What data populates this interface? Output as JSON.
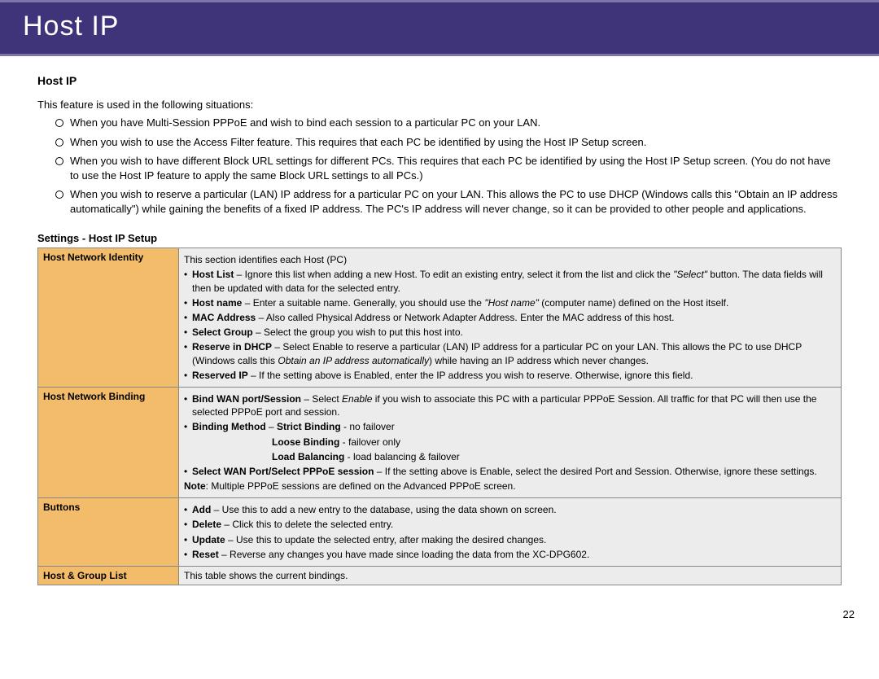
{
  "header": {
    "title": "Host IP"
  },
  "section_title": "Host IP",
  "intro": "This feature is used in the following situations:",
  "situations": [
    "When you have Multi-Session PPPoE and wish to bind each session to a particular PC on your LAN.",
    "When you wish to use the Access Filter feature. This requires that each PC be identified by using the Host IP Setup screen.",
    "When you wish to have different Block URL settings for different PCs. This requires that each PC be identified by using the Host IP Setup screen. (You do not have to use the Host IP feature to apply the same Block URL settings to all PCs.)",
    "When you wish to reserve a particular (LAN) IP address for a particular PC on your LAN. This allows the PC to use DHCP (Windows calls this \"Obtain an IP address automatically\") while gaining the benefits of a fixed IP address. The PC's IP address will never change, so it can be provided to other people and applications."
  ],
  "sub_title": "Settings - Host IP Setup",
  "rows": {
    "identity": {
      "label": "Host Network Identity",
      "intro": "This section identifies each Host (PC)",
      "hostlist_label": "Host List",
      "hostlist_text_a": " – Ignore this list when adding a new Host. To edit an existing entry, select it from the list and click the ",
      "hostlist_ital": "\"Select\"",
      "hostlist_text_b": " button. The data fields will then be updated with data for the selected entry.",
      "hostname_label": "Host name",
      "hostname_text_a": " – Enter a suitable name. Generally, you should use the ",
      "hostname_ital": "\"Host name\"",
      "hostname_text_b": " (computer name) defined on the Host itself.",
      "mac_label": "MAC Address",
      "mac_text": " – Also called Physical Address or Network Adapter Address. Enter the MAC address of this host.",
      "selgrp_label": "Select Group",
      "selgrp_text": " – Select the group you wish to put this host into.",
      "resdhcp_label": "Reserve in DHCP",
      "resdhcp_text_a": " – Select Enable to reserve a particular (LAN) IP address for a particular PC on your LAN. This allows the PC to use DHCP (Windows calls this ",
      "resdhcp_ital": "Obtain an IP address automatically",
      "resdhcp_text_b": ") while having an IP address which never changes.",
      "resip_label": "Reserved IP",
      "resip_text": " – If the setting above is Enabled, enter the IP address you wish to reserve. Otherwise, ignore this field."
    },
    "binding": {
      "label": "Host Network Binding",
      "bindwan_label": "Bind WAN port/Session",
      "bindwan_text_a": " – Select ",
      "bindwan_ital": "Enable",
      "bindwan_text_b": " if you wish to associate this PC with a particular PPPoE Session. All traffic for that PC will then use the selected PPPoE port and session.",
      "method_label": "Binding Method",
      "method_dash": " – ",
      "strict_label": "Strict Binding",
      "strict_text": " - no failover",
      "loose_label": "Loose Binding",
      "loose_text": " - failover only",
      "lb_label": "Load Balancing",
      "lb_text": " - load balancing & failover",
      "selwan_label": "Select WAN Port/Select PPPoE session",
      "selwan_text": " – If the setting above is Enable, select the desired Port and Session. Otherwise, ignore these settings.",
      "note_label": "Note",
      "note_text": ": Multiple PPPoE sessions are defined on the Advanced PPPoE screen."
    },
    "buttons": {
      "label": "Buttons",
      "add_label": "Add",
      "add_text": " – Use this to add a new entry to the database, using the data shown on screen.",
      "del_label": "Delete",
      "del_text": " – Click this to delete the selected entry.",
      "upd_label": "Update",
      "upd_text": " – Use this to update the selected entry, after making the desired changes.",
      "rst_label": "Reset",
      "rst_text": " – Reverse any changes you have made since loading the data from the XC-DPG602."
    },
    "list": {
      "label": "Host & Group List",
      "text": "This table shows the current bindings."
    }
  },
  "page_number": "22"
}
